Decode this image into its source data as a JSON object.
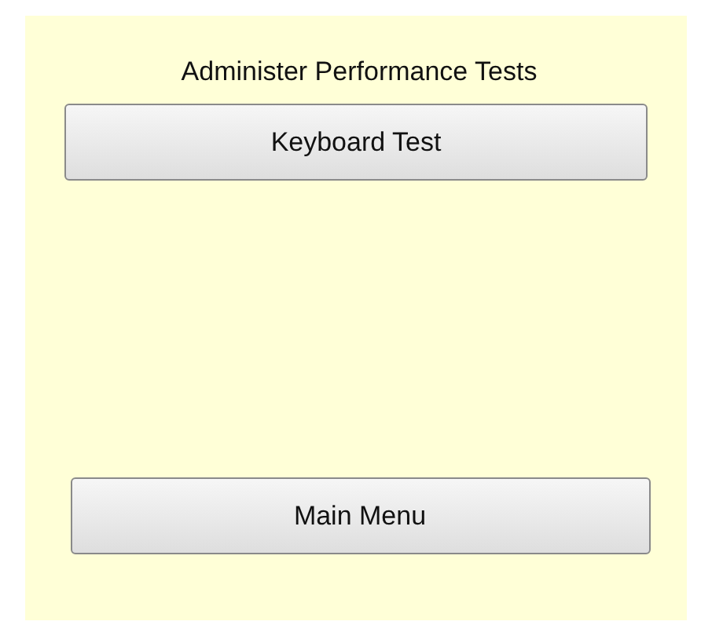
{
  "heading": "Administer Performance Tests",
  "buttons": [
    {
      "label": "Keyboard Test"
    },
    {
      "label": "Main Menu"
    }
  ]
}
